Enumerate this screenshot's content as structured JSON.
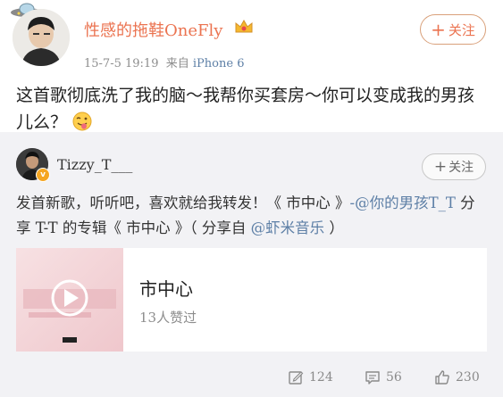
{
  "post": {
    "username": "性感的拖鞋OneFly",
    "follow_label": "关注",
    "timestamp": "15-7-5 19:19",
    "source_prefix": "来自",
    "device": "iPhone 6",
    "text": "这首歌彻底洗了我的脑～我帮你买套房～你可以变成我的男孩儿么？"
  },
  "repost": {
    "username": "Tizzy_T___",
    "follow_label": "关注",
    "text_part1": "发首新歌，听听吧，喜欢就给我转发！《 市中心 》",
    "mention_user": "-@你的男孩T_T",
    "text_part2": " 分享 T-T 的专辑《 市中心 》（ 分享自 ",
    "mention_app": "@虾米音乐",
    "text_part3": " ）",
    "card": {
      "title": "市中心",
      "likes": "13人赞过"
    }
  },
  "actions": {
    "repost_count": "124",
    "comment_count": "56",
    "like_count": "230"
  },
  "colors": {
    "username": "#eb7350",
    "link": "#5d7fa6",
    "panel_bg": "#f2f2f5"
  }
}
